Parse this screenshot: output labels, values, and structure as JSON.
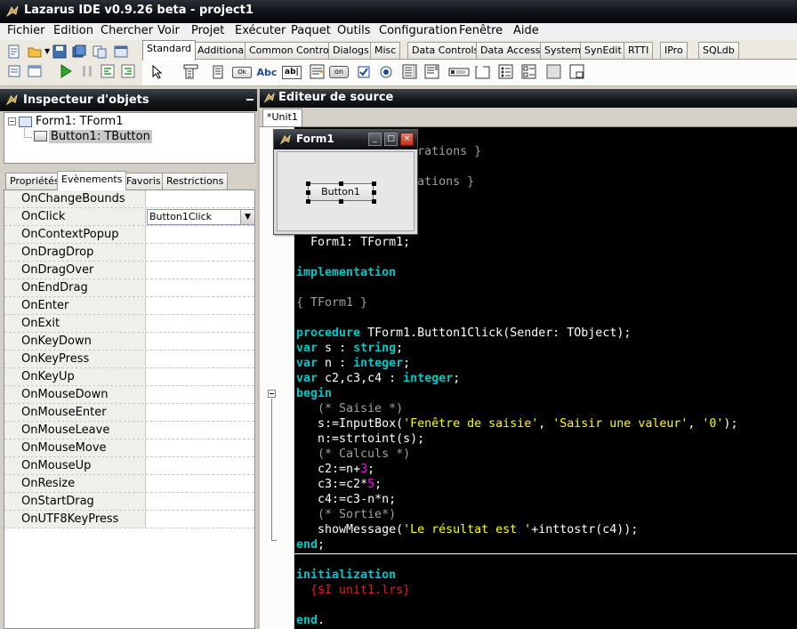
{
  "window": {
    "title": "Lazarus IDE v0.9.26 beta - project1"
  },
  "menu": [
    "Fichier",
    "Edition",
    "Chercher",
    "Voir",
    "Projet",
    "Exécuter",
    "Paquet",
    "Outils",
    "Configuration",
    "Fenêtre",
    "Aide"
  ],
  "palette": {
    "tabs": [
      "Standard",
      "Additional",
      "Common Controls",
      "Dialogs",
      "Misc",
      "Data Controls",
      "Data Access",
      "System",
      "SynEdit",
      "RTTI",
      "IPro",
      "SQLdb"
    ],
    "active_tab": "Standard",
    "component_icons": [
      "pointer-arrow",
      "tmainmenu",
      "tpopupmenu",
      "tbutton",
      "tlabel",
      "tedit",
      "tmemo",
      "ttogglebox",
      "tcheckbox",
      "tradiobutton",
      "tlistbox",
      "tcombobox",
      "tscrollbar",
      "tgroupbox",
      "tradiogroup",
      "tcheckgroup",
      "tpanel",
      "tframe",
      "tactionlist"
    ],
    "component_glyphs": {
      "tbutton": "Ok",
      "tlabel": "Abc",
      "tedit": "ab|",
      "ttogglebox": "on"
    }
  },
  "inspector": {
    "title": "Inspecteur d'objets",
    "tree": [
      {
        "label": "Form1: TForm1",
        "selected": false
      },
      {
        "label": "Button1: TButton",
        "selected": true
      }
    ],
    "tabs": [
      "Propriétés",
      "Evènements",
      "Favoris",
      "Restrictions"
    ],
    "active_tab": "Evènements",
    "events": [
      {
        "name": "OnChangeBounds",
        "value": ""
      },
      {
        "name": "OnClick",
        "value": "Button1Click"
      },
      {
        "name": "OnContextPopup",
        "value": ""
      },
      {
        "name": "OnDragDrop",
        "value": ""
      },
      {
        "name": "OnDragOver",
        "value": ""
      },
      {
        "name": "OnEndDrag",
        "value": ""
      },
      {
        "name": "OnEnter",
        "value": ""
      },
      {
        "name": "OnExit",
        "value": ""
      },
      {
        "name": "OnKeyDown",
        "value": ""
      },
      {
        "name": "OnKeyPress",
        "value": ""
      },
      {
        "name": "OnKeyUp",
        "value": ""
      },
      {
        "name": "OnMouseDown",
        "value": ""
      },
      {
        "name": "OnMouseEnter",
        "value": ""
      },
      {
        "name": "OnMouseLeave",
        "value": ""
      },
      {
        "name": "OnMouseMove",
        "value": ""
      },
      {
        "name": "OnMouseUp",
        "value": ""
      },
      {
        "name": "OnResize",
        "value": ""
      },
      {
        "name": "OnStartDrag",
        "value": ""
      },
      {
        "name": "OnUTF8KeyPress",
        "value": ""
      }
    ]
  },
  "editor": {
    "title": "Editeur de source",
    "tab": "*Unit1",
    "lines": [
      {
        "text": "  { Private declarations }",
        "kind": "comment"
      },
      {
        "text": "  { Public declarations }",
        "kind": "comment"
      },
      {
        "text": "  Form1: TForm1;",
        "kind": "plain"
      },
      {
        "text": "implementation",
        "kind": "keyword"
      },
      {
        "text": "{ TForm1 }",
        "kind": "comment"
      },
      {
        "text": "procedure TForm1.Button1Click(Sender: TObject);",
        "kind": "code"
      },
      {
        "text": "var s : string;",
        "kind": "code"
      },
      {
        "text": "var n : integer;",
        "kind": "code"
      },
      {
        "text": "var c2,c3,c4 : integer;",
        "kind": "code"
      },
      {
        "text": "begin",
        "kind": "keyword"
      },
      {
        "text": "   (* Saisie *)",
        "kind": "comment"
      },
      {
        "text": "   s:=InputBox('Fenêtre de saisie', 'Saisir une valeur', '0');",
        "kind": "code"
      },
      {
        "text": "   n:=strtoint(s);",
        "kind": "code"
      },
      {
        "text": "   (* Calculs *)",
        "kind": "comment"
      },
      {
        "text": "   c2:=n+3;",
        "kind": "code"
      },
      {
        "text": "   c3:=c2*5;",
        "kind": "code"
      },
      {
        "text": "   c4:=c3-n*n;",
        "kind": "code"
      },
      {
        "text": "   (* Sortie*)",
        "kind": "comment"
      },
      {
        "text": "   showMessage('Le résultat est '+inttostr(c4));",
        "kind": "code"
      },
      {
        "text": "end;",
        "kind": "keyword"
      },
      {
        "text": "initialization",
        "kind": "keyword"
      },
      {
        "text": "  {$I unit1.lrs}",
        "kind": "directive"
      },
      {
        "text": "end.",
        "kind": "keyword"
      }
    ]
  },
  "designer": {
    "form_caption": "Form1",
    "button_caption": "Button1"
  },
  "colors": {
    "editor_bg": "#000000",
    "keyword": "#00c8c8",
    "comment": "#a0a0a0",
    "string": "#ffff00",
    "number": "#ff00ff",
    "directive": "#e02020"
  }
}
